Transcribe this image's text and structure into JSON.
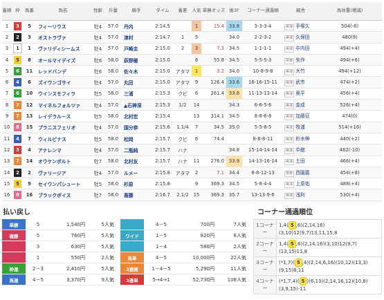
{
  "headers": [
    "着順",
    "枠",
    "馬番",
    "馬名",
    "性齢",
    "斤量",
    "騎手",
    "タイム",
    "着差",
    "人気",
    "単勝オッズ",
    "後3F",
    "コーナー通過順",
    "厩舎",
    "馬体重(増減)"
  ],
  "rows": [
    {
      "rank": "1",
      "waku": "3",
      "ban": "5",
      "name": "フィーリウス",
      "sex": "牡4",
      "kin": "57.0",
      "jockey": "丹内",
      "time": "2:14.5",
      "diff": "",
      "pop": "1",
      "odds": "15.4",
      "f3": "33.8",
      "corner": "3-3-3-4",
      "region": "美浦",
      "trainer": "手塚久",
      "weight": "504(-8)",
      "wc": "#d43b3b"
    },
    {
      "rank": "2",
      "waku": "2",
      "ban": "3",
      "name": "オストラヴァ",
      "sex": "牡4",
      "kin": "57.0",
      "jockey": "津村",
      "time": "2:14.7",
      "diff": "1",
      "pop": "5",
      "odds": "",
      "f3": "34.0",
      "corner": "2-2-3-2",
      "region": "美浦",
      "trainer": "久保田",
      "weight": "480(9)",
      "wc": "#222222"
    },
    {
      "rank": "3",
      "waku": "1",
      "ban": "1",
      "name": "ヴァリディシームス",
      "sex": "牡4",
      "kin": "57.0",
      "jockey": "戸崎圭",
      "time": "2:15.0",
      "diff": "2",
      "pop": "3",
      "odds": "7.3",
      "f3": "34.5",
      "corner": "1-1-1-1",
      "region": "美浦",
      "trainer": "中内田",
      "weight": "494(+4)",
      "wc": "#ffffff"
    },
    {
      "rank": "4",
      "waku": "5",
      "ban": "8",
      "name": "オールマイデイズ",
      "sex": "牡6",
      "kin": "58.0",
      "jockey": "荻野極",
      "time": "2:15.0",
      "diff": "",
      "pop": "8",
      "odds": "55.8",
      "f3": "34.5",
      "corner": "5-5-5-3",
      "region": "栗東",
      "trainer": "矢作",
      "weight": "494(+6)",
      "wc": "#f2d233"
    },
    {
      "rank": "5",
      "waku": "6",
      "ban": "11",
      "name": "レッドバンデ",
      "sex": "牡6",
      "kin": "58.0",
      "jockey": "佐々木",
      "time": "2:15.0",
      "diff": "アタマ",
      "pop": "1",
      "odds": "3.2",
      "f3": "34.0",
      "corner": "10-8-9-8",
      "region": "美浦",
      "trainer": "大竹",
      "weight": "494(+12)",
      "wc": "#3aa03a"
    },
    {
      "rank": "6",
      "waku": "4",
      "ban": "6",
      "name": "ズイウンゴサイ",
      "sex": "牡4",
      "kin": "57.0",
      "jockey": "丸田",
      "time": "2:15.0",
      "diff": "アタマ",
      "pop": "9",
      "odds": "126.4",
      "f3": "33.6",
      "corner": "16-16-15-11",
      "region": "美浦",
      "trainer": "武市",
      "weight": "474(+2)",
      "wc": "#3a5fb8"
    },
    {
      "rank": "7",
      "waku": "6",
      "ban": "10",
      "name": "ウインスモフィラ",
      "sex": "牡5",
      "kin": "58.0",
      "jockey": "三浦",
      "time": "2:15.3",
      "diff": "クビ",
      "pop": "6",
      "odds": "261.4",
      "f3": "33.8",
      "corner": "11-13-13-14",
      "region": "美浦",
      "trainer": "奥平",
      "weight": "456(+4)",
      "wc": "#3aa03a"
    },
    {
      "rank": "8",
      "waku": "7",
      "ban": "12",
      "name": "マイネルフォルツァ",
      "sex": "牡4",
      "kin": "57.0",
      "jockey": "▲石神深",
      "time": "2:15.3",
      "diff": "1/2",
      "pop": "14",
      "odds": "",
      "f3": "34.3",
      "corner": "6-6-5-6",
      "region": "美浦",
      "trainer": "金成",
      "weight": "526(+4)",
      "wc": "#e8883a"
    },
    {
      "rank": "9",
      "waku": "7",
      "ban": "13",
      "name": "レイデラルース",
      "sex": "牡5",
      "kin": "58.0",
      "jockey": "北村宏",
      "time": "2:15.4",
      "diff": "",
      "pop": "13",
      "odds": "314.1",
      "f3": "34.5",
      "corner": "8-8-6-8",
      "region": "美浦",
      "trainer": "加藤征",
      "weight": "474(0)",
      "wc": "#e8883a"
    },
    {
      "rank": "10",
      "waku": "8",
      "ban": "15",
      "name": "プラニスフェリオ",
      "sex": "牡4",
      "kin": "57.0",
      "jockey": "国分恭",
      "time": "2:15.6",
      "diff": "1.1/4",
      "pop": "7",
      "odds": "34.5",
      "f3": "35.0",
      "corner": "5-5-8-5",
      "region": "美浦",
      "trainer": "牧浦",
      "weight": "514(+16)",
      "wc": "#e86a8a"
    },
    {
      "rank": "11",
      "waku": "4",
      "ban": "7",
      "name": "ウィルビナス",
      "sex": "牡5",
      "kin": "58.0",
      "jockey": "松岡",
      "time": "2:15.7",
      "diff": "クビ",
      "pop": "6",
      "odds": "74.4",
      "f3": "",
      "corner": "8-8-8-11",
      "region": "美浦",
      "trainer": "鈴木伸",
      "weight": "440(+2)",
      "wc": "#3a5fb8"
    },
    {
      "rank": "12",
      "waku": "3",
      "ban": "4",
      "name": "アナレンマ",
      "sex": "牡4",
      "kin": "57.0",
      "jockey": "二瓶純",
      "time": "2:15.7",
      "diff": "ハナ",
      "pop": "",
      "odds": "",
      "f3": "34.8",
      "corner": "15-14-14-14",
      "region": "美浦",
      "trainer": "中舘",
      "weight": "462(-10)",
      "wc": "#d43b3b"
    },
    {
      "rank": "13",
      "waku": "7",
      "ban": "14",
      "name": "オウケンボルト",
      "sex": "牡7",
      "kin": "58.0",
      "jockey": "北村友",
      "time": "2:15.7",
      "diff": "ハナ",
      "pop": "11",
      "odds": "276.0",
      "f3": "33.9",
      "corner": "14-13-16-14",
      "region": "美浦",
      "trainer": "土田",
      "weight": "466(+4)",
      "wc": "#e8883a"
    },
    {
      "rank": "14",
      "waku": "2",
      "ban": "2",
      "name": "ヴァリージア",
      "sex": "牡4",
      "kin": "57.0",
      "jockey": "ルメー",
      "time": "2:15.8",
      "diff": "アタマ",
      "pop": "2",
      "odds": "7.1",
      "f3": "34.4",
      "corner": "8-8-12-13",
      "region": "栗東",
      "trainer": "西園義",
      "weight": "454(+8)",
      "wc": "#222222"
    },
    {
      "rank": "15",
      "waku": "5",
      "ban": "9",
      "name": "セイウンパシュート",
      "sex": "牡5",
      "kin": "58.0",
      "jockey": "杉原",
      "time": "2:15.8",
      "diff": "",
      "pop": "9",
      "odds": "369.3",
      "f3": "34.5",
      "corner": "5-8-4-4",
      "region": "美浦",
      "trainer": "上原佑",
      "weight": "488(+4)",
      "wc": "#f2d233"
    },
    {
      "rank": "16",
      "waku": "8",
      "ban": "16",
      "name": "ブラックボイス",
      "sex": "牡7",
      "kin": "58.0",
      "jockey": "斎藤",
      "time": "2:16.7",
      "diff": "2.1/2",
      "pop": "15",
      "odds": "369.3",
      "f3": "35.7",
      "corner": "13-13-9-6",
      "region": "美浦",
      "trainer": "浅利",
      "weight": "530(+4)",
      "wc": "#e86a8a"
    }
  ],
  "payout": {
    "title": "払い戻し",
    "left": [
      {
        "label": "単勝",
        "color": "#3a73c9",
        "combo": "5",
        "amount": "1,540円",
        "pop": "5人気"
      },
      {
        "label": "複勝",
        "color": "#d43b5a",
        "combo": "5",
        "amount": "760円",
        "pop": "5人気"
      },
      {
        "label": "",
        "color": "#d43b5a",
        "combo": "3",
        "amount": "630円",
        "pop": "5人気"
      },
      {
        "label": "",
        "color": "#d43b5a",
        "combo": "1",
        "amount": "550円",
        "pop": "2人気"
      },
      {
        "label": "枠連",
        "color": "#3aa03a",
        "combo": "2－3",
        "amount": "2,410円",
        "pop": "5人気"
      },
      {
        "label": "馬連",
        "color": "#3a73c9",
        "combo": "4－5",
        "amount": "3,370円",
        "pop": "9人気"
      }
    ],
    "right": [
      {
        "label": "",
        "color": "#3aa9c9",
        "combo": "4－5",
        "amount": "700円",
        "pop": "7人気"
      },
      {
        "label": "ワイド",
        "color": "#3aa9c9",
        "combo": "1－5",
        "amount": "820円",
        "pop": "8人気"
      },
      {
        "label": "",
        "color": "#3aa9c9",
        "combo": "1－4",
        "amount": "580円",
        "pop": "2人気"
      },
      {
        "label": "馬単",
        "color": "#e8883a",
        "combo": "4－5",
        "amount": "10,000円",
        "pop": "22人気"
      },
      {
        "label": "3連複",
        "color": "#e8883a",
        "combo": "1－4－5",
        "amount": "5,290円",
        "pop": "11人気"
      },
      {
        "label": "3連単",
        "color": "#d43b3b",
        "combo": "5→4→1",
        "amount": "52,730円",
        "pop": "108人気"
      }
    ]
  },
  "corners": {
    "title": "コーナー通過順位",
    "rows": [
      {
        "label": "1コーナー",
        "pre": "1,4(",
        "hl": "5",
        "post": ",6)(2,14,16)(3,10)12(9,7)13,11,15,8"
      },
      {
        "label": "2コーナー",
        "pre": "1,4(",
        "hl": "5",
        "post": ",6)(2,14,16)(3,10)12(9,7)(13,15)11,8"
      },
      {
        "label": "3コーナー",
        "pre": "(*1,7)(",
        "hl": "5",
        "post": ",4)(2,14,6,16)(10,12)(13,3)(9,15)8,11"
      },
      {
        "label": "4コーナー",
        "pre": "(*1,7,4)(",
        "hl": "5",
        "post": ")(6,13)(2,14,16,12)(10,8)(3,9,15)-11"
      }
    ]
  }
}
